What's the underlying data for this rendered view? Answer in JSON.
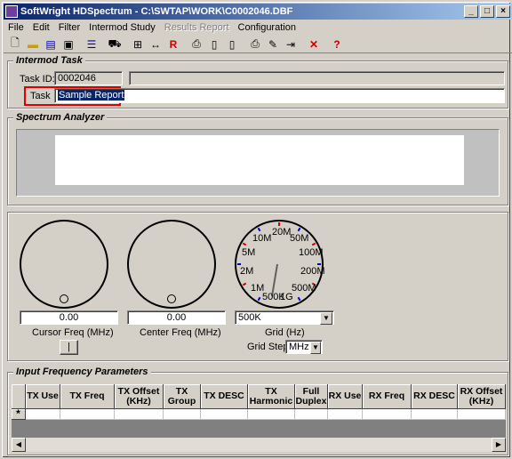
{
  "window": {
    "title": "SoftWright HDSpectrum - C:\\SWTAP\\WORK\\C0002046.DBF",
    "min": "_",
    "max": "□",
    "close": "×"
  },
  "menu": [
    "File",
    "Edit",
    "Filter",
    "Intermod Study",
    "Results Report",
    "Configuration"
  ],
  "intermod_task": {
    "title": "Intermod Task",
    "task_id_label": "Task ID:",
    "task_id_value": "0002046",
    "task_label": "Task",
    "task_value": "Sample Report"
  },
  "spectrum": {
    "title": "Spectrum Analyzer"
  },
  "controls": {
    "cursor_value": "0.00",
    "cursor_label": "Cursor Freq (MHz)",
    "cursor_button": "|",
    "center_value": "0.00",
    "center_label": "Center Freq (MHz)",
    "grid_value": "500K",
    "grid_label": "Grid (Hz)",
    "grid_step_label": "Grid Step",
    "grid_step_value": "MHz",
    "dial_marks": [
      "10M",
      "20M",
      "50M",
      "5M",
      "100M",
      "2M",
      "200M",
      "1M",
      "500M",
      "500K",
      "1G"
    ]
  },
  "input_params": {
    "title": "Input Frequency Parameters",
    "row_marker": "*",
    "columns": [
      "TX Use",
      "TX Freq",
      "TX Offset (KHz)",
      "TX Group",
      "TX DESC",
      "TX Harmonic",
      "Full Duplex",
      "RX Use",
      "RX Freq",
      "RX DESC",
      "RX Offset (KHz)"
    ]
  },
  "colors": {
    "task_highlight": "#e00000",
    "selection": "#0a246a"
  }
}
